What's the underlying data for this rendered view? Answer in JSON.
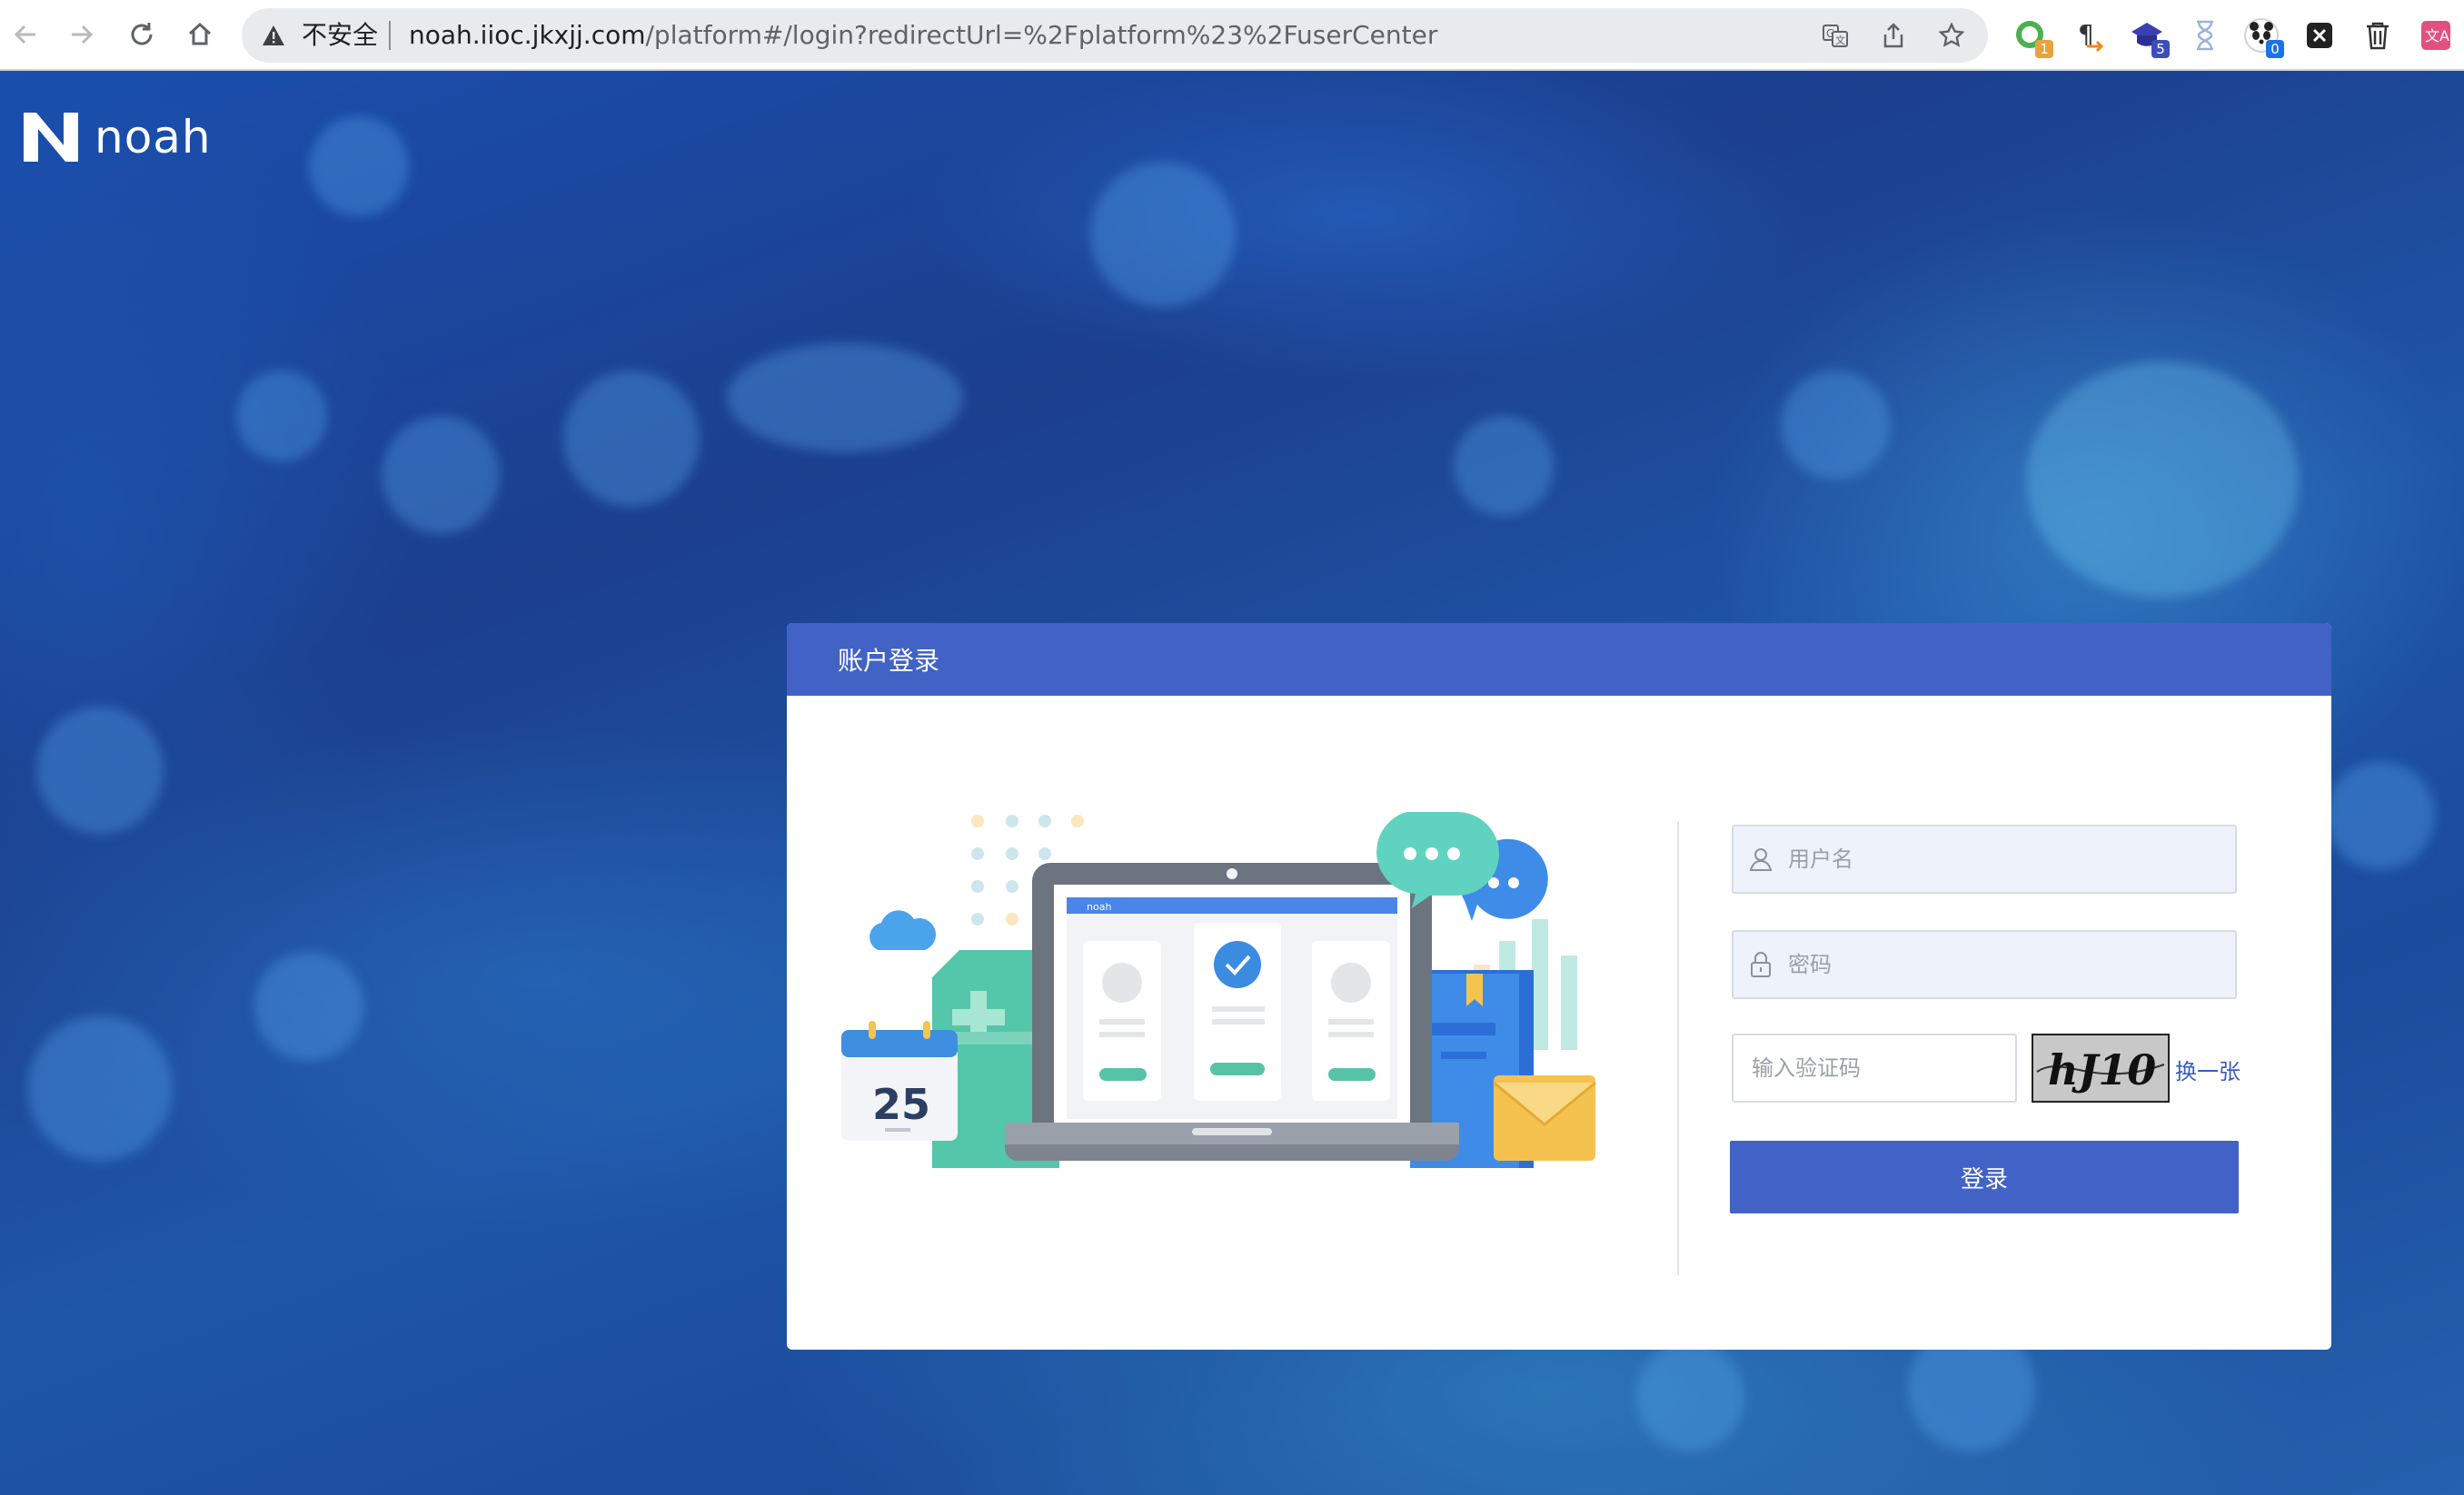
{
  "browser": {
    "security_label": "不安全",
    "url_host": "noah.iioc.jkxjj.com",
    "url_path": "/platform#/login?redirectUrl=%2Fplatform%23%2FuserCenter",
    "extensions": [
      {
        "icon": "green-circle-extension-icon",
        "badge": "1",
        "badge_color": "#e8a33b"
      },
      {
        "icon": "pilcrow-extension-icon",
        "badge": "",
        "badge_color": ""
      },
      {
        "icon": "purple-cap-extension-icon",
        "badge": "5",
        "badge_color": "#3c4fb8"
      },
      {
        "icon": "hourglass-extension-icon",
        "badge": "",
        "badge_color": ""
      },
      {
        "icon": "panda-extension-icon",
        "badge": "0",
        "badge_color": "#1a73e8"
      },
      {
        "icon": "x-extension-icon",
        "badge": "",
        "badge_color": ""
      },
      {
        "icon": "trash-extension-icon",
        "badge": "",
        "badge_color": ""
      },
      {
        "icon": "translate-extension-icon",
        "badge": "",
        "badge_color": ""
      }
    ]
  },
  "brand": {
    "name": "noah"
  },
  "login": {
    "title": "账户登录",
    "username_placeholder": "用户名",
    "password_placeholder": "密码",
    "captcha_placeholder": "输入验证码",
    "captcha_text": "hJ10",
    "refresh_label": "换一张",
    "submit_label": "登录",
    "illustration": {
      "calendar_day": "25",
      "mini_brand": "noah"
    }
  },
  "colors": {
    "primary": "#4262c6",
    "link": "#3c5bc4",
    "background": "#1c4c9e"
  }
}
